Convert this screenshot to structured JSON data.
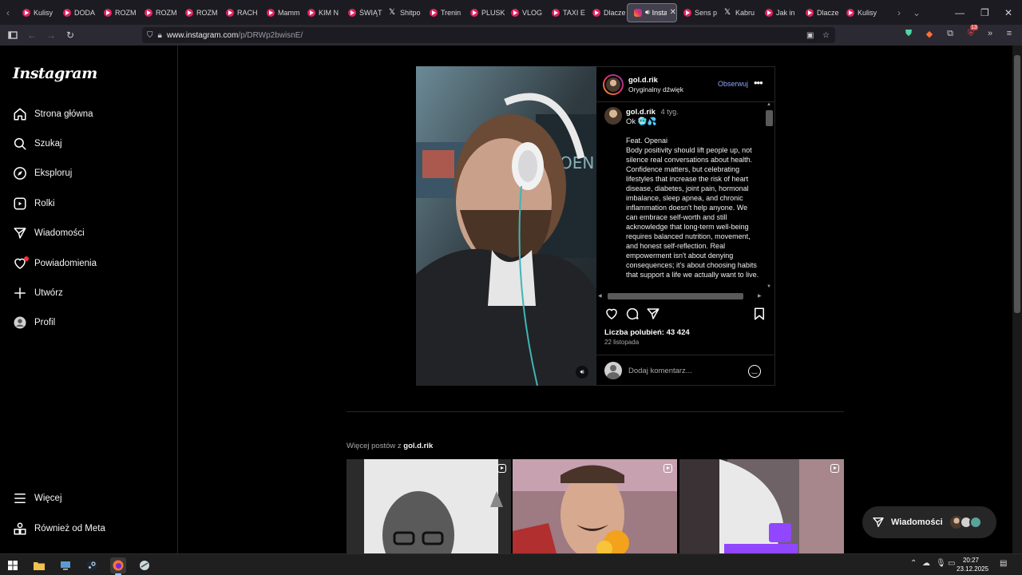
{
  "browser": {
    "tabs": [
      {
        "label": "Kulisy",
        "icon": "youtube-icon"
      },
      {
        "label": "DODA",
        "icon": "youtube-icon"
      },
      {
        "label": "ROZM",
        "icon": "youtube-icon"
      },
      {
        "label": "ROZM",
        "icon": "youtube-icon"
      },
      {
        "label": "ROZM",
        "icon": "youtube-icon"
      },
      {
        "label": "RACH",
        "icon": "youtube-icon"
      },
      {
        "label": "Mamm",
        "icon": "youtube-icon"
      },
      {
        "label": "KIM N",
        "icon": "youtube-icon"
      },
      {
        "label": "ŚWIĄT",
        "icon": "youtube-icon"
      },
      {
        "label": "Shitpo",
        "icon": "x-icon"
      },
      {
        "label": "Trenin",
        "icon": "youtube-icon"
      },
      {
        "label": "PLUSK",
        "icon": "youtube-icon"
      },
      {
        "label": "VLOG",
        "icon": "youtube-icon"
      },
      {
        "label": "TAXI E",
        "icon": "youtube-icon"
      },
      {
        "label": "Dlacze",
        "icon": "youtube-icon"
      },
      {
        "label": "Insta",
        "icon": "instagram-icon",
        "active": true
      },
      {
        "label": "Sens p",
        "icon": "youtube-icon"
      },
      {
        "label": "Kabru",
        "icon": "x-icon"
      },
      {
        "label": "Jak in",
        "icon": "youtube-icon"
      },
      {
        "label": "Dlacze",
        "icon": "youtube-icon"
      },
      {
        "label": "Kulisy",
        "icon": "youtube-icon"
      }
    ],
    "url_domain": "www.instagram.com",
    "url_path": "/p/DRWp2bwisnE/",
    "notification_badge": "13"
  },
  "sidebar": {
    "logo": "Instagram",
    "items": [
      {
        "label": "Strona główna",
        "icon": "home-icon"
      },
      {
        "label": "Szukaj",
        "icon": "search-icon"
      },
      {
        "label": "Eksploruj",
        "icon": "compass-icon"
      },
      {
        "label": "Rolki",
        "icon": "reels-icon"
      },
      {
        "label": "Wiadomości",
        "icon": "messenger-icon"
      },
      {
        "label": "Powiadomienia",
        "icon": "heart-icon"
      },
      {
        "label": "Utwórz",
        "icon": "plus-icon"
      },
      {
        "label": "Profil",
        "icon": "profile-icon"
      }
    ],
    "bottom_items": [
      {
        "label": "Więcej",
        "icon": "menu-icon"
      },
      {
        "label": "Również od Meta",
        "icon": "meta-icon"
      }
    ]
  },
  "post": {
    "username": "gol.d.rik",
    "audio": "Oryginalny dźwięk",
    "follow_label": "Obserwuj",
    "caption_time": "4 tyg.",
    "caption_first": "Ok 🥶💦",
    "caption_body": "Feat. Openai\nBody positivity should lift people up, not silence real conversations about health. Confidence matters, but celebrating lifestyles that increase the risk of heart disease, diabetes, joint pain, hormonal imbalance, sleep apnea, and chronic inflammation doesn't help anyone. We can embrace self-worth and still acknowledge that long-term well-being requires balanced nutrition, movement, and honest self-reflection. Real empowerment isn't about denying consequences; it's about choosing habits that support a life we actually want to live.",
    "likes": "Liczba polubień: 43 424",
    "date": "22 listopada",
    "comment_placeholder": "Dodaj komentarz..."
  },
  "more_posts": {
    "prefix": "Więcej postów z ",
    "username": "gol.d.rik"
  },
  "messages_pill": {
    "label": "Wiadomości"
  },
  "taskbar": {
    "time": "20:27",
    "date": "23.12.2025"
  },
  "colors": {
    "accent_link": "#8fa5ff",
    "background": "#000000",
    "border": "#262626"
  }
}
